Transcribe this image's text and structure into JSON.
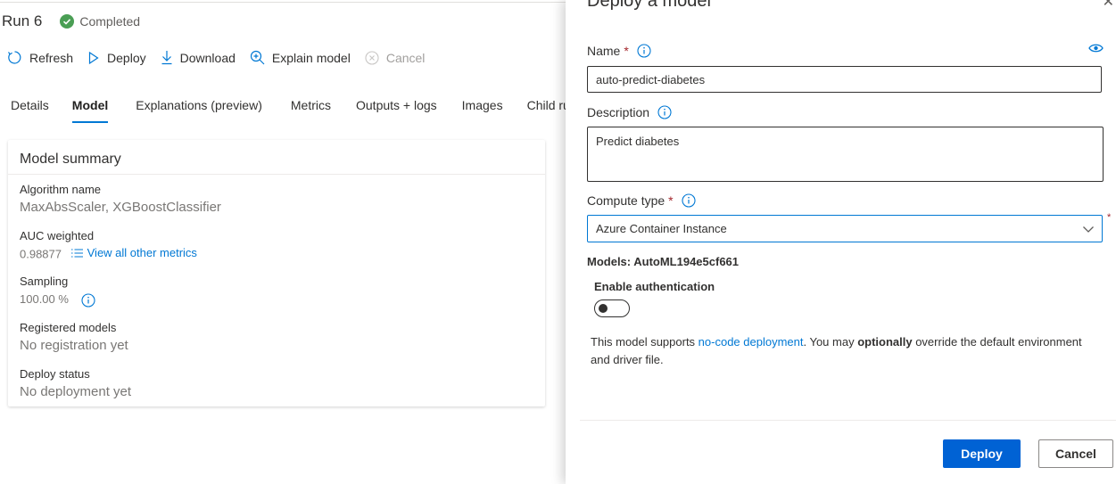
{
  "run": {
    "title": "Run 6",
    "status": "Completed"
  },
  "toolbar": {
    "refresh": "Refresh",
    "deploy": "Deploy",
    "download": "Download",
    "explain": "Explain model",
    "cancel": "Cancel"
  },
  "tabs": [
    "Details",
    "Model",
    "Explanations (preview)",
    "Metrics",
    "Outputs + logs",
    "Images",
    "Child ru"
  ],
  "active_tab": "Model",
  "summary": {
    "title": "Model summary",
    "algorithm_label": "Algorithm name",
    "algorithm_value": "MaxAbsScaler, XGBoostClassifier",
    "auc_label": "AUC weighted",
    "auc_value": "0.98877",
    "metrics_link": "View all other metrics",
    "sampling_label": "Sampling",
    "sampling_value": "100.00 %",
    "registered_label": "Registered models",
    "registered_value": "No registration yet",
    "deploy_status_label": "Deploy status",
    "deploy_status_value": "No deployment yet"
  },
  "panel": {
    "title": "Deploy a model",
    "name_label": "Name",
    "name_value": "auto-predict-diabetes",
    "description_label": "Description",
    "description_value": "Predict diabetes",
    "compute_label": "Compute type",
    "compute_value": "Azure Container Instance",
    "required_mark": "*",
    "models_line": "Models: AutoML194e5cf661",
    "enable_auth_label": "Enable authentication",
    "enable_auth_on": false,
    "note_part1": "This model supports ",
    "note_link": "no-code deployment",
    "note_part2": ". You may ",
    "note_bold": "optionally",
    "note_part3": " override the default environment and driver file.",
    "deploy_button": "Deploy",
    "cancel_button": "Cancel"
  },
  "colors": {
    "accent": "#0078d4",
    "primary_button": "#0062d4",
    "success": "#4a9e54",
    "required": "#a4262c"
  }
}
